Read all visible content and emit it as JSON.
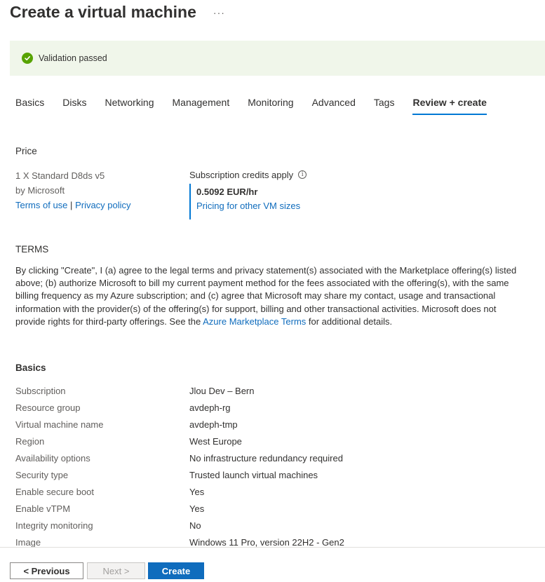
{
  "header": {
    "title": "Create a virtual machine",
    "more_label": "···"
  },
  "validation": {
    "icon": "check-circle-icon",
    "text": "Validation passed",
    "color": "#57a300",
    "background": "#f0f6ea"
  },
  "tabs": [
    {
      "label": "Basics",
      "active": false
    },
    {
      "label": "Disks",
      "active": false
    },
    {
      "label": "Networking",
      "active": false
    },
    {
      "label": "Management",
      "active": false
    },
    {
      "label": "Monitoring",
      "active": false
    },
    {
      "label": "Advanced",
      "active": false
    },
    {
      "label": "Tags",
      "active": false
    },
    {
      "label": "Review + create",
      "active": true
    }
  ],
  "price": {
    "heading": "Price",
    "product": "1 X Standard D8ds v5",
    "publisher": "by Microsoft",
    "terms_link": "Terms of use",
    "separator": "|",
    "privacy_link": "Privacy policy",
    "credits_label": "Subscription credits apply",
    "info_icon": "info-icon",
    "rate": "0.5092 EUR/hr",
    "pricing_link": "Pricing for other VM sizes"
  },
  "terms": {
    "heading": "TERMS",
    "text_before": "By clicking \"Create\", I (a) agree to the legal terms and privacy statement(s) associated with the Marketplace offering(s) listed above; (b) authorize Microsoft to bill my current payment method for the fees associated with the offering(s), with the same billing frequency as my Azure subscription; and (c) agree that Microsoft may share my contact, usage and transactional information with the provider(s) of the offering(s) for support, billing and other transactional activities. Microsoft does not provide rights for third-party offerings. See the ",
    "link": "Azure Marketplace Terms",
    "text_after": " for additional details."
  },
  "basics": {
    "heading": "Basics",
    "rows": [
      {
        "key": "Subscription",
        "value": "Jlou Dev – Bern"
      },
      {
        "key": "Resource group",
        "value": "avdeph-rg"
      },
      {
        "key": "Virtual machine name",
        "value": "avdeph-tmp"
      },
      {
        "key": "Region",
        "value": "West Europe"
      },
      {
        "key": "Availability options",
        "value": "No infrastructure redundancy required"
      },
      {
        "key": "Security type",
        "value": "Trusted launch virtual machines"
      },
      {
        "key": "Enable secure boot",
        "value": "Yes"
      },
      {
        "key": "Enable vTPM",
        "value": "Yes"
      },
      {
        "key": "Integrity monitoring",
        "value": "No"
      },
      {
        "key": "Image",
        "value": "Windows 11 Pro, version 22H2 - Gen2"
      }
    ]
  },
  "footer": {
    "previous_label": "< Previous",
    "next_label": "Next >",
    "create_label": "Create",
    "accent": "#0f6cbd"
  }
}
